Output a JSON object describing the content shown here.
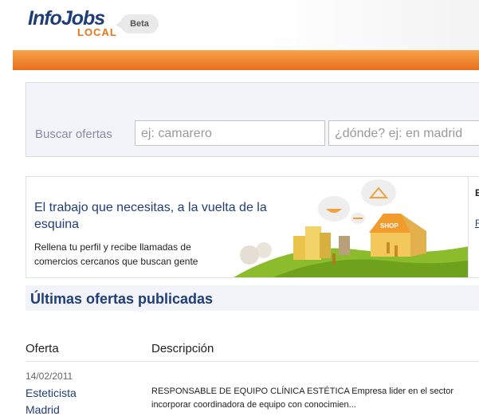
{
  "header": {
    "logo_main": "InfoJobs",
    "logo_sub": "LOCAL",
    "beta_badge": "Beta"
  },
  "search": {
    "label": "Buscar ofertas",
    "what_placeholder": "ej: camarero",
    "where_placeholder": "¿dónde? ej: en madrid"
  },
  "promo": {
    "title": "El trabajo que necesitas, a la vuelta de la esquina",
    "text": "Rellena tu perfil y recibe llamadas de comercios cercanos que buscan gente",
    "shop_sign": "SHOP",
    "side_heading_partial": "E",
    "side_link_partial": "R"
  },
  "latest": {
    "title": "Últimas ofertas publicadas",
    "columns": [
      "Oferta",
      "Descripción"
    ],
    "rows": [
      {
        "date": "14/02/2011",
        "title": "Esteticista",
        "location": "Madrid",
        "description_line1": "RESPONSABLE DE EQUIPO CLÍNICA ESTÉTICA Empresa lider en el sector",
        "description_line2": "incorporar coordinadora de equipo con conocimien..."
      }
    ]
  },
  "colors": {
    "brand_blue": "#1f3e78",
    "brand_orange": "#e8701b",
    "panel_bg": "#f2f4f9"
  }
}
